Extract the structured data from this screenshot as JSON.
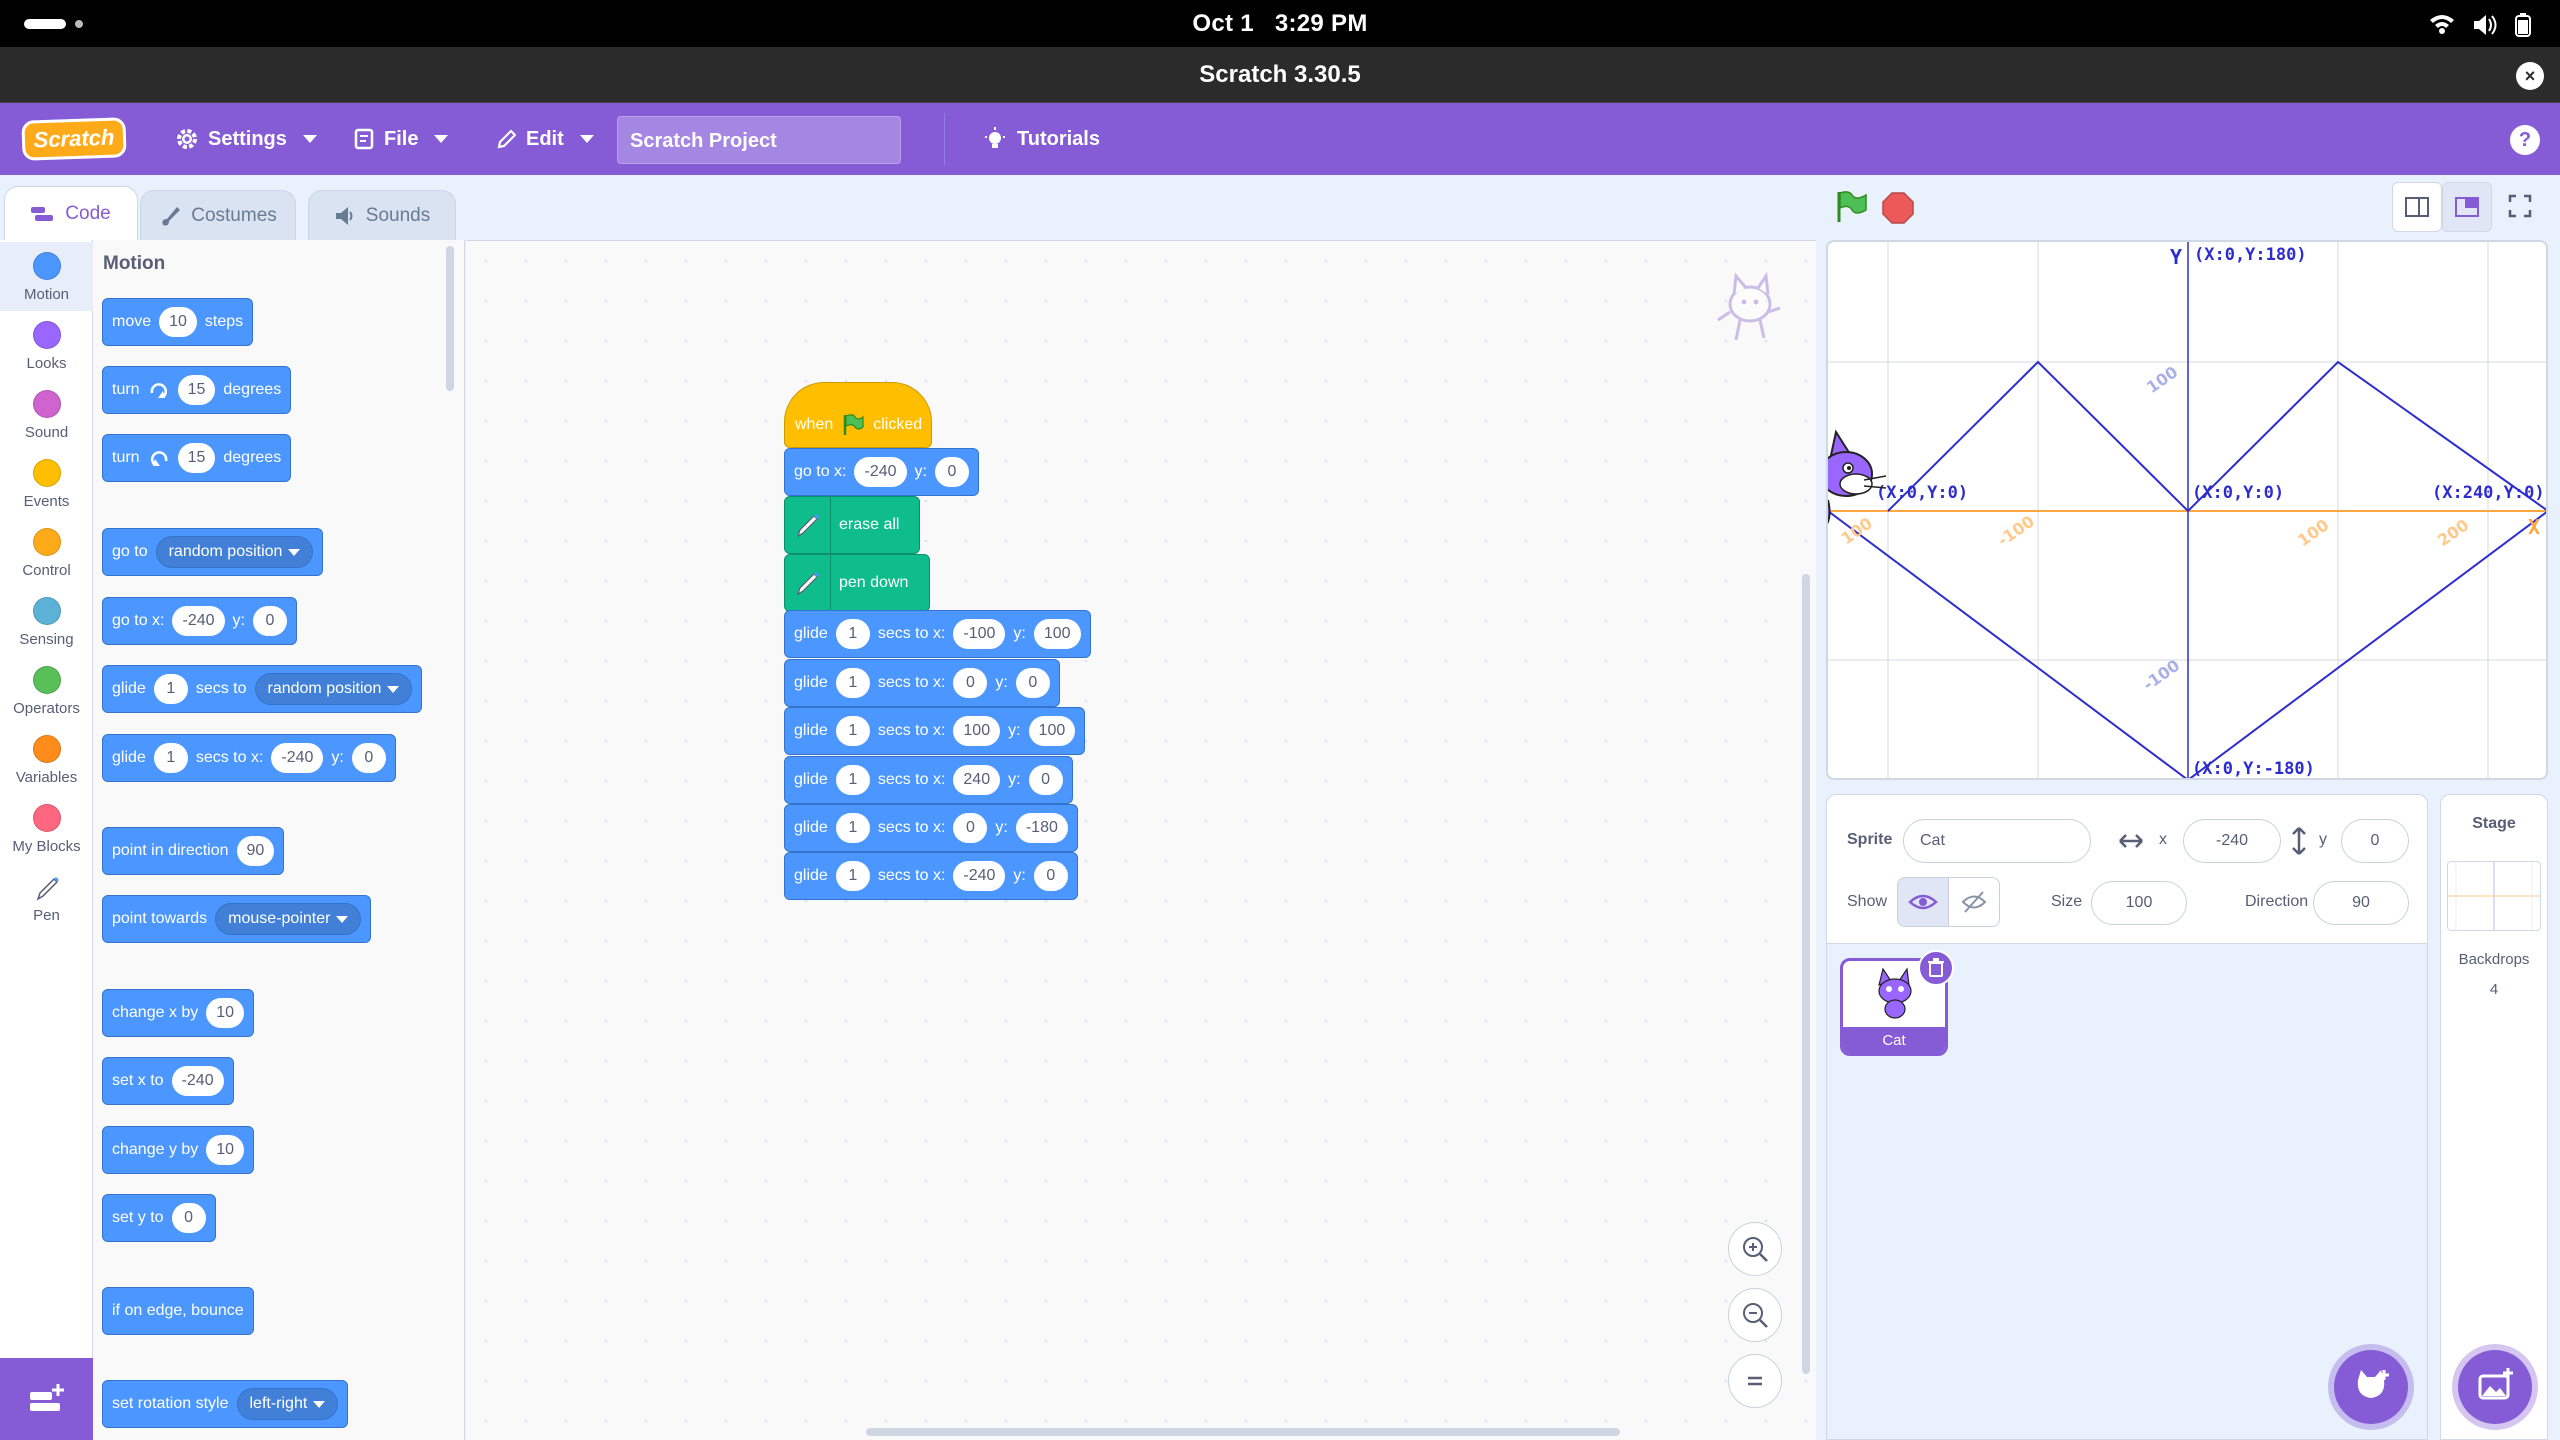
{
  "status_bar": {
    "date": "Oct 1",
    "time": "3:29 PM"
  },
  "window": {
    "title": "Scratch 3.30.5",
    "close": "×"
  },
  "menu": {
    "logo": "Scratch",
    "settings": "Settings",
    "file": "File",
    "edit": "Edit",
    "project_title": "Scratch Project",
    "tutorials": "Tutorials",
    "help": "?"
  },
  "tabs": {
    "code": "Code",
    "costumes": "Costumes",
    "sounds": "Sounds"
  },
  "categories": [
    {
      "label": "Motion",
      "color": "#4c97ff"
    },
    {
      "label": "Looks",
      "color": "#9966ff"
    },
    {
      "label": "Sound",
      "color": "#cf63cf"
    },
    {
      "label": "Events",
      "color": "#ffbf00"
    },
    {
      "label": "Control",
      "color": "#ffab19"
    },
    {
      "label": "Sensing",
      "color": "#5cb1d6"
    },
    {
      "label": "Operators",
      "color": "#59c059"
    },
    {
      "label": "Variables",
      "color": "#ff8c1a"
    },
    {
      "label": "My Blocks",
      "color": "#ff6680"
    },
    {
      "label": "Pen",
      "color": "#0fbd8c"
    }
  ],
  "palette": {
    "heading": "Motion",
    "move": {
      "pre": "move",
      "val": "10",
      "post": "steps"
    },
    "turn_right": {
      "pre": "turn",
      "val": "15",
      "post": "degrees"
    },
    "turn_left": {
      "pre": "turn",
      "val": "15",
      "post": "degrees"
    },
    "goto": {
      "pre": "go to",
      "drop": "random position"
    },
    "goto_xy": {
      "pre": "go to x:",
      "x": "-240",
      "y_label": "y:",
      "y": "0"
    },
    "glide_to": {
      "pre": "glide",
      "val": "1",
      "mid": "secs to",
      "drop": "random position"
    },
    "glide_xy": {
      "pre": "glide",
      "val": "1",
      "mid": "secs to x:",
      "x": "-240",
      "y_label": "y:",
      "y": "0"
    },
    "point_dir": {
      "pre": "point in direction",
      "val": "90"
    },
    "point_towards": {
      "pre": "point towards",
      "drop": "mouse-pointer"
    },
    "change_x": {
      "pre": "change x by",
      "val": "10"
    },
    "set_x": {
      "pre": "set x to",
      "val": "-240"
    },
    "change_y": {
      "pre": "change y by",
      "val": "10"
    },
    "set_y": {
      "pre": "set y to",
      "val": "0"
    },
    "bounce": {
      "pre": "if on edge, bounce"
    },
    "rotation": {
      "pre": "set rotation style",
      "drop": "left-right"
    }
  },
  "script": {
    "hat": {
      "pre": "when",
      "post": "clicked"
    },
    "goto": {
      "pre": "go to x:",
      "x": "-240",
      "y_label": "y:",
      "y": "0"
    },
    "erase": "erase all",
    "pendown": "pen down",
    "glides": [
      {
        "pre": "glide",
        "secs": "1",
        "mid": "secs to x:",
        "x": "-100",
        "y_label": "y:",
        "y": "100"
      },
      {
        "pre": "glide",
        "secs": "1",
        "mid": "secs to x:",
        "x": "0",
        "y_label": "y:",
        "y": "0"
      },
      {
        "pre": "glide",
        "secs": "1",
        "mid": "secs to x:",
        "x": "100",
        "y_label": "y:",
        "y": "100"
      },
      {
        "pre": "glide",
        "secs": "1",
        "mid": "secs to x:",
        "x": "240",
        "y_label": "y:",
        "y": "0"
      },
      {
        "pre": "glide",
        "secs": "1",
        "mid": "secs to x:",
        "x": "0",
        "y_label": "y:",
        "y": "-180"
      },
      {
        "pre": "glide",
        "secs": "1",
        "mid": "secs to x:",
        "x": "-240",
        "y_label": "y:",
        "y": "0"
      }
    ]
  },
  "stage_labels": {
    "y_axis": "Y",
    "x_axis": "X",
    "top": "(X:0,Y:180)",
    "origin": "(X:0,Y:0)",
    "right": "(X:240,Y:0)",
    "left": "(X:0,Y:0)",
    "bottom": "(X:0,Y:-180)",
    "t100a": "100",
    "t100b": "-100",
    "t100c": "100",
    "t200": "200",
    "t100d": "-100",
    "t100e": "100",
    "t100f": "-100"
  },
  "sprite_info": {
    "sprite_label": "Sprite",
    "sprite_name": "Cat",
    "x_label": "x",
    "x": "-240",
    "y_label": "y",
    "y": "0",
    "show_label": "Show",
    "size_label": "Size",
    "size": "100",
    "direction_label": "Direction",
    "direction": "90"
  },
  "sprite_list": [
    {
      "name": "Cat"
    }
  ],
  "stage_pane": {
    "title": "Stage",
    "backdrops_label": "Backdrops",
    "backdrops_count": "4"
  },
  "colors": {
    "accent": "#855cd6",
    "motion": "#4c97ff",
    "events": "#ffbf00",
    "pen": "#0fbd8c"
  }
}
